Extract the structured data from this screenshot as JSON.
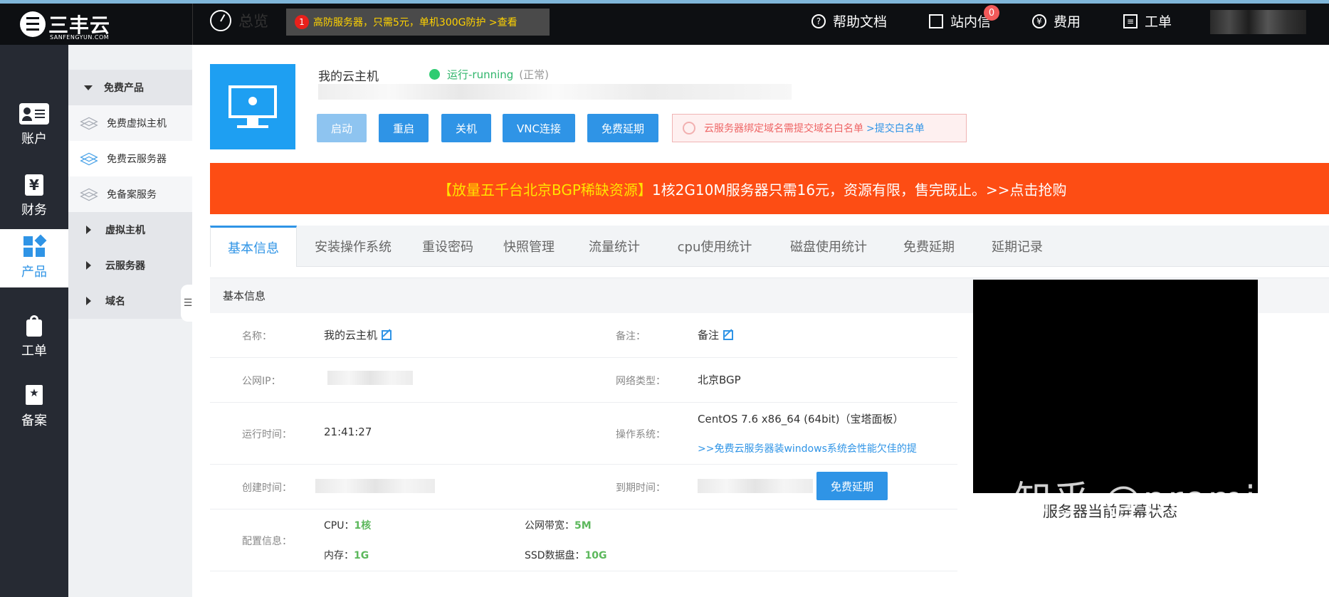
{
  "topbar": {
    "brand": "三丰云",
    "brand_sub": "SANFENGYUN.COM",
    "overview": "总览",
    "promo_badge": "1",
    "promo_text": "高防服务器，只需5元，单机300G防护 >查看",
    "nav": {
      "help": "帮助文档",
      "messages": "站内信",
      "messages_count": "0",
      "fees": "费用",
      "tickets": "工单"
    }
  },
  "sidebar": {
    "items": [
      {
        "label": "账户",
        "icon": "account-card-icon"
      },
      {
        "label": "财务",
        "icon": "yuan-icon"
      },
      {
        "label": "产品",
        "icon": "grid-icon"
      },
      {
        "label": "工单",
        "icon": "bag-icon"
      },
      {
        "label": "备案",
        "icon": "star-stamp-icon"
      }
    ]
  },
  "subnav": {
    "free_products": "免费产品",
    "free_vhost": "免费虚拟主机",
    "free_cloud": "免费云服务器",
    "free_no_filing": "免备案服务",
    "vhost": "虚拟主机",
    "cloud": "云服务器",
    "domain": "域名"
  },
  "host": {
    "name": "我的云主机",
    "status": "运行-running",
    "status_note": "(正常)",
    "buttons": {
      "start": "启动",
      "restart": "重启",
      "shutdown": "关机",
      "vnc": "VNC连接",
      "extend": "免费延期"
    },
    "notice": "云服务器绑定域名需提交域名白名单",
    "notice_link": ">提交白名单"
  },
  "banner": {
    "highlight": "【放量五千台北京BGP稀缺资源】",
    "text": " 1核2G10M服务器只需16元，资源有限，售完既止。>>点击抢购"
  },
  "tabs": [
    "基本信息",
    "安装操作系统",
    "重设密码",
    "快照管理",
    "流量统计",
    "cpu使用统计",
    "磁盘使用统计",
    "免费延期",
    "延期记录"
  ],
  "info": {
    "section_title": "基本信息",
    "name_label": "名称：",
    "name_value": "我的云主机",
    "remark_label": "备注：",
    "remark_value": "备注",
    "ip_label": "公网IP：",
    "net_label": "网络类型：",
    "net_value": "北京BGP",
    "uptime_label": "运行时间：",
    "uptime_value": "21:41:27",
    "os_label": "操作系统：",
    "os_value": "CentOS 7.6 x86_64 (64bit)（宝塔面板）",
    "os_link": ">>免费云服务器装windows系统会性能欠佳的提",
    "created_label": "创建时间：",
    "expire_label": "到期时间：",
    "extend_button": "免费延期",
    "config_label": "配置信息：",
    "cpu_label": "CPU：",
    "cpu_value": "1核",
    "bandwidth_label": "公网带宽：",
    "bandwidth_value": "5M",
    "mem_label": "内存：",
    "mem_value": "1G",
    "disk_label": "SSD数据盘：",
    "disk_value": "10G"
  },
  "screen": {
    "caption": "服务器当前屏幕状态"
  },
  "watermark": "知乎 @promise"
}
